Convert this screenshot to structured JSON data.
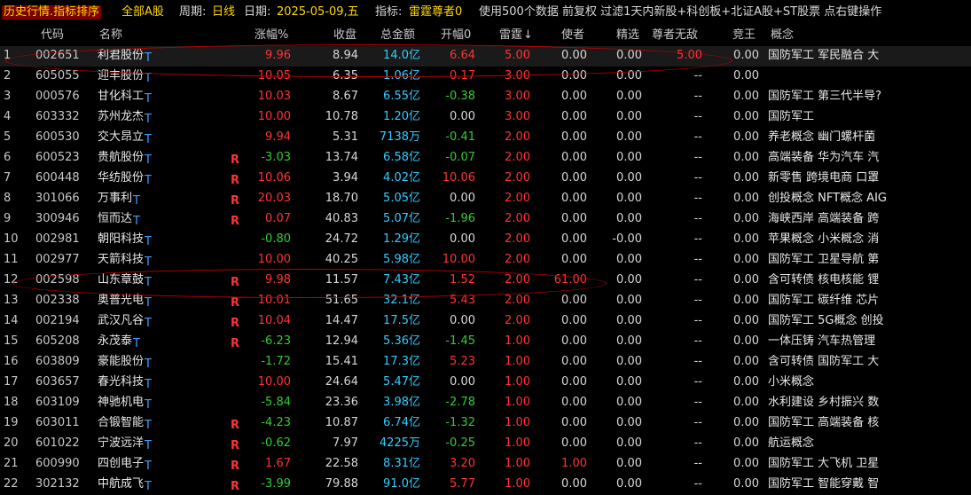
{
  "title_bar": {
    "mode": "历史行情.指标排序",
    "market": "全部A股",
    "period_label": "周期:",
    "period_value": "日线",
    "date_label": "日期:",
    "date_value": "2025-05-09,五",
    "indicator_label": "指标:",
    "indicator_value": "雷霆尊者0",
    "info": "使用500个数据 前复权 过滤1天内新股+科创板+北证A股+ST股票 点右键操作"
  },
  "columns": [
    "代码",
    "名称",
    "涨幅%",
    "收盘",
    "总金额",
    "开幅0",
    "雷霆",
    "使者",
    "精选",
    "尊者无敌",
    "竞王",
    "概念"
  ],
  "sort_column": "雷霆",
  "colors": {
    "up": "#ff3333",
    "down": "#33cc33",
    "amount": "#33ccff",
    "tmark": "#3aa0ff"
  },
  "rows": [
    {
      "idx": "1",
      "code": "002651",
      "name": "利君股份",
      "r": "",
      "chg": "9.96",
      "close": "8.94",
      "amt": "14.0亿",
      "open": "6.64",
      "lei": "5.00",
      "shi": "0.00",
      "jx": "0.00",
      "zz": "5.00",
      "jw": "0.00",
      "gn": "国防军工 军民融合 大"
    },
    {
      "idx": "2",
      "code": "605055",
      "name": "迎丰股份",
      "r": "",
      "chg": "10.05",
      "close": "6.35",
      "amt": "1.06亿",
      "open": "0.17",
      "lei": "3.00",
      "shi": "0.00",
      "jx": "0.00",
      "zz": "--",
      "jw": "0.00",
      "gn": ""
    },
    {
      "idx": "3",
      "code": "000576",
      "name": "甘化科工",
      "r": "",
      "chg": "10.03",
      "close": "8.67",
      "amt": "6.55亿",
      "open": "-0.38",
      "lei": "3.00",
      "shi": "0.00",
      "jx": "0.00",
      "zz": "--",
      "jw": "0.00",
      "gn": "国防军工 第三代半导?"
    },
    {
      "idx": "4",
      "code": "603332",
      "name": "苏州龙杰",
      "r": "",
      "chg": "10.00",
      "close": "10.78",
      "amt": "1.20亿",
      "open": "0.00",
      "lei": "3.00",
      "shi": "0.00",
      "jx": "0.00",
      "zz": "--",
      "jw": "0.00",
      "gn": "国防军工"
    },
    {
      "idx": "5",
      "code": "600530",
      "name": "交大昂立",
      "r": "",
      "chg": "9.94",
      "close": "5.31",
      "amt": "7138万",
      "open": "-0.41",
      "lei": "2.00",
      "shi": "0.00",
      "jx": "0.00",
      "zz": "--",
      "jw": "0.00",
      "gn": "养老概念 幽门螺杆菌"
    },
    {
      "idx": "6",
      "code": "600523",
      "name": "贵航股份",
      "r": "R",
      "chg": "-3.03",
      "close": "13.74",
      "amt": "6.58亿",
      "open": "-0.07",
      "lei": "2.00",
      "shi": "0.00",
      "jx": "0.00",
      "zz": "--",
      "jw": "0.00",
      "gn": "高端装备 华为汽车 汽"
    },
    {
      "idx": "7",
      "code": "600448",
      "name": "华纺股份",
      "r": "R",
      "chg": "10.06",
      "close": "3.94",
      "amt": "4.02亿",
      "open": "10.06",
      "lei": "2.00",
      "shi": "0.00",
      "jx": "0.00",
      "zz": "--",
      "jw": "0.00",
      "gn": "新零售 跨境电商 口罩"
    },
    {
      "idx": "8",
      "code": "301066",
      "name": "万事利",
      "r": "R",
      "chg": "20.03",
      "close": "18.70",
      "amt": "5.05亿",
      "open": "0.00",
      "lei": "2.00",
      "shi": "0.00",
      "jx": "0.00",
      "zz": "--",
      "jw": "0.00",
      "gn": "创投概念 NFT概念 AIG"
    },
    {
      "idx": "9",
      "code": "300946",
      "name": "恒而达",
      "r": "R",
      "chg": "0.07",
      "close": "40.83",
      "amt": "5.07亿",
      "open": "-1.96",
      "lei": "2.00",
      "shi": "0.00",
      "jx": "0.00",
      "zz": "--",
      "jw": "0.00",
      "gn": "海峡西岸 高端装备 跨"
    },
    {
      "idx": "10",
      "code": "002981",
      "name": "朝阳科技",
      "r": "",
      "chg": "-0.80",
      "close": "24.72",
      "amt": "1.29亿",
      "open": "0.00",
      "lei": "2.00",
      "shi": "0.00",
      "jx": "-0.00",
      "zz": "--",
      "jw": "0.00",
      "gn": "苹果概念 小米概念 消"
    },
    {
      "idx": "11",
      "code": "002977",
      "name": "天箭科技",
      "r": "",
      "chg": "10.00",
      "close": "40.25",
      "amt": "5.98亿",
      "open": "10.00",
      "lei": "2.00",
      "shi": "0.00",
      "jx": "0.00",
      "zz": "--",
      "jw": "0.00",
      "gn": "国防军工 卫星导航 第"
    },
    {
      "idx": "12",
      "code": "002598",
      "name": "山东章鼓",
      "r": "R",
      "chg": "9.98",
      "close": "11.57",
      "amt": "7.43亿",
      "open": "1.52",
      "lei": "2.00",
      "shi": "61.00",
      "jx": "0.00",
      "zz": "--",
      "jw": "0.00",
      "gn": "含可转债 核电核能 锂"
    },
    {
      "idx": "13",
      "code": "002338",
      "name": "奥普光电",
      "r": "R",
      "chg": "10.01",
      "close": "51.65",
      "amt": "32.1亿",
      "open": "5.43",
      "lei": "2.00",
      "shi": "0.00",
      "jx": "0.00",
      "zz": "--",
      "jw": "0.00",
      "gn": "国防军工 碳纤维 芯片"
    },
    {
      "idx": "14",
      "code": "002194",
      "name": "武汉凡谷",
      "r": "R",
      "chg": "10.04",
      "close": "14.47",
      "amt": "17.5亿",
      "open": "0.00",
      "lei": "2.00",
      "shi": "0.00",
      "jx": "0.00",
      "zz": "--",
      "jw": "0.00",
      "gn": "国防军工 5G概念 创投"
    },
    {
      "idx": "15",
      "code": "605208",
      "name": "永茂泰",
      "r": "R",
      "chg": "-6.23",
      "close": "12.94",
      "amt": "5.36亿",
      "open": "-1.45",
      "lei": "1.00",
      "shi": "0.00",
      "jx": "0.00",
      "zz": "--",
      "jw": "0.00",
      "gn": "一体压铸 汽车热管理"
    },
    {
      "idx": "16",
      "code": "603809",
      "name": "豪能股份",
      "r": "",
      "chg": "-1.72",
      "close": "15.41",
      "amt": "17.3亿",
      "open": "5.23",
      "lei": "1.00",
      "shi": "0.00",
      "jx": "0.00",
      "zz": "--",
      "jw": "0.00",
      "gn": "含可转债 国防军工 大"
    },
    {
      "idx": "17",
      "code": "603657",
      "name": "春光科技",
      "r": "",
      "chg": "10.00",
      "close": "24.64",
      "amt": "5.47亿",
      "open": "0.00",
      "lei": "1.00",
      "shi": "0.00",
      "jx": "0.00",
      "zz": "--",
      "jw": "0.00",
      "gn": "小米概念"
    },
    {
      "idx": "18",
      "code": "603109",
      "name": "神驰机电",
      "r": "",
      "chg": "-5.84",
      "close": "23.36",
      "amt": "3.98亿",
      "open": "-2.78",
      "lei": "1.00",
      "shi": "0.00",
      "jx": "0.00",
      "zz": "--",
      "jw": "0.00",
      "gn": "水利建设 乡村振兴 数"
    },
    {
      "idx": "19",
      "code": "603011",
      "name": "合锻智能",
      "r": "R",
      "chg": "-4.23",
      "close": "10.87",
      "amt": "6.74亿",
      "open": "-1.32",
      "lei": "1.00",
      "shi": "0.00",
      "jx": "0.00",
      "zz": "--",
      "jw": "0.00",
      "gn": "国防军工 高端装备 核"
    },
    {
      "idx": "20",
      "code": "601022",
      "name": "宁波远洋",
      "r": "R",
      "chg": "-0.62",
      "close": "7.97",
      "amt": "4225万",
      "open": "-0.25",
      "lei": "1.00",
      "shi": "0.00",
      "jx": "0.00",
      "zz": "--",
      "jw": "0.00",
      "gn": "航运概念"
    },
    {
      "idx": "21",
      "code": "600990",
      "name": "四创电子",
      "r": "R",
      "chg": "1.67",
      "close": "22.58",
      "amt": "8.31亿",
      "open": "3.20",
      "lei": "1.00",
      "shi": "1.00",
      "jx": "0.00",
      "zz": "--",
      "jw": "0.00",
      "gn": "国防军工 大飞机 卫星"
    },
    {
      "idx": "22",
      "code": "302132",
      "name": "中航成飞",
      "r": "R",
      "chg": "-3.99",
      "close": "79.88",
      "amt": "91.0亿",
      "open": "5.77",
      "lei": "1.00",
      "shi": "0.00",
      "jx": "0.00",
      "zz": "--",
      "jw": "0.00",
      "gn": "国防军工 智能穿戴 智"
    }
  ]
}
